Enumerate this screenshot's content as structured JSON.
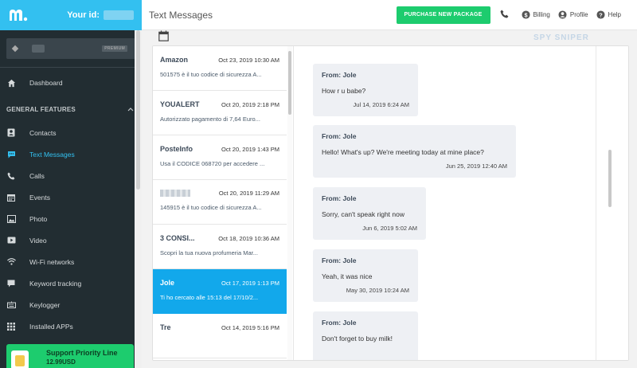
{
  "sidebar": {
    "your_id_label": "Your id:",
    "account_badge": "PREMIUM",
    "dashboard": "Dashboard",
    "section_title": "GENERAL FEATURES",
    "items": [
      {
        "label": "Contacts",
        "icon": "contacts-icon"
      },
      {
        "label": "Text Messages",
        "icon": "message-icon",
        "active": true
      },
      {
        "label": "Calls",
        "icon": "phone-icon"
      },
      {
        "label": "Events",
        "icon": "calendar-icon"
      },
      {
        "label": "Photo",
        "icon": "photo-icon"
      },
      {
        "label": "Video",
        "icon": "video-icon"
      },
      {
        "label": "Wi-Fi networks",
        "icon": "wifi-icon"
      },
      {
        "label": "Keyword tracking",
        "icon": "keyword-icon"
      },
      {
        "label": "Keylogger",
        "icon": "keyboard-icon"
      },
      {
        "label": "Installed APPs",
        "icon": "apps-icon"
      }
    ],
    "support_line": "Support Priority Line",
    "support_price": "12.99USD"
  },
  "header": {
    "title": "Text Messages",
    "purchase_label": "PURCHASE NEW PACKAGE",
    "billing_label": "Billing",
    "profile_label": "Profile",
    "help_label": "Help"
  },
  "watermark": "SPY SNIPER",
  "threads": [
    {
      "name": "Amazon",
      "date": "Oct 23, 2019 10:30 AM",
      "snippet": "501575 è il tuo codice di sicurezza A..."
    },
    {
      "name": "YOUALERT",
      "date": "Oct 20, 2019 2:18 PM",
      "snippet": "Autorizzato pagamento di 7,64 Euro..."
    },
    {
      "name": "PosteInfo",
      "date": "Oct 20, 2019 1:43 PM",
      "snippet": "Usa il CODICE 068720 per accedere ..."
    },
    {
      "name": "",
      "date": "Oct 20, 2019 11:29 AM",
      "snippet": "145915 è il tuo codice di sicurezza A..."
    },
    {
      "name": "3 CONSI...",
      "date": "Oct 18, 2019 10:36 AM",
      "snippet": "Scopri la tua nuova profumeria Mar..."
    },
    {
      "name": "Jole",
      "date": "Oct 17, 2019 1:13 PM",
      "snippet": "Ti ho cercato alle 15:13 del 17/10/2...",
      "selected": true
    },
    {
      "name": "Tre",
      "date": "Oct 14, 2019 5:16 PM",
      "snippet": ""
    }
  ],
  "messages": [
    {
      "from": "From: Jole",
      "text": "How r u babe?",
      "time": "Jul 14, 2019 6:24 AM"
    },
    {
      "from": "From: Jole",
      "text": "Hello! What's up? We're meeting today at mine place?",
      "time": "Jun 25, 2019 12:40 AM"
    },
    {
      "from": "From: Jole",
      "text": "Sorry, can't speak right now",
      "time": "Jun 6, 2019 5:02 AM"
    },
    {
      "from": "From: Jole",
      "text": "Yeah, it was nice",
      "time": "May 30, 2019 10:24 AM"
    },
    {
      "from": "From: Jole",
      "text": "Don't forget to buy milk!",
      "time": ""
    }
  ],
  "colors": {
    "accent": "#33c0f0",
    "sidebar_bg": "#222d32",
    "selected_row": "#12a8eb",
    "purchase_green": "#1dcc6e",
    "bubble_bg": "#eef0f4"
  }
}
